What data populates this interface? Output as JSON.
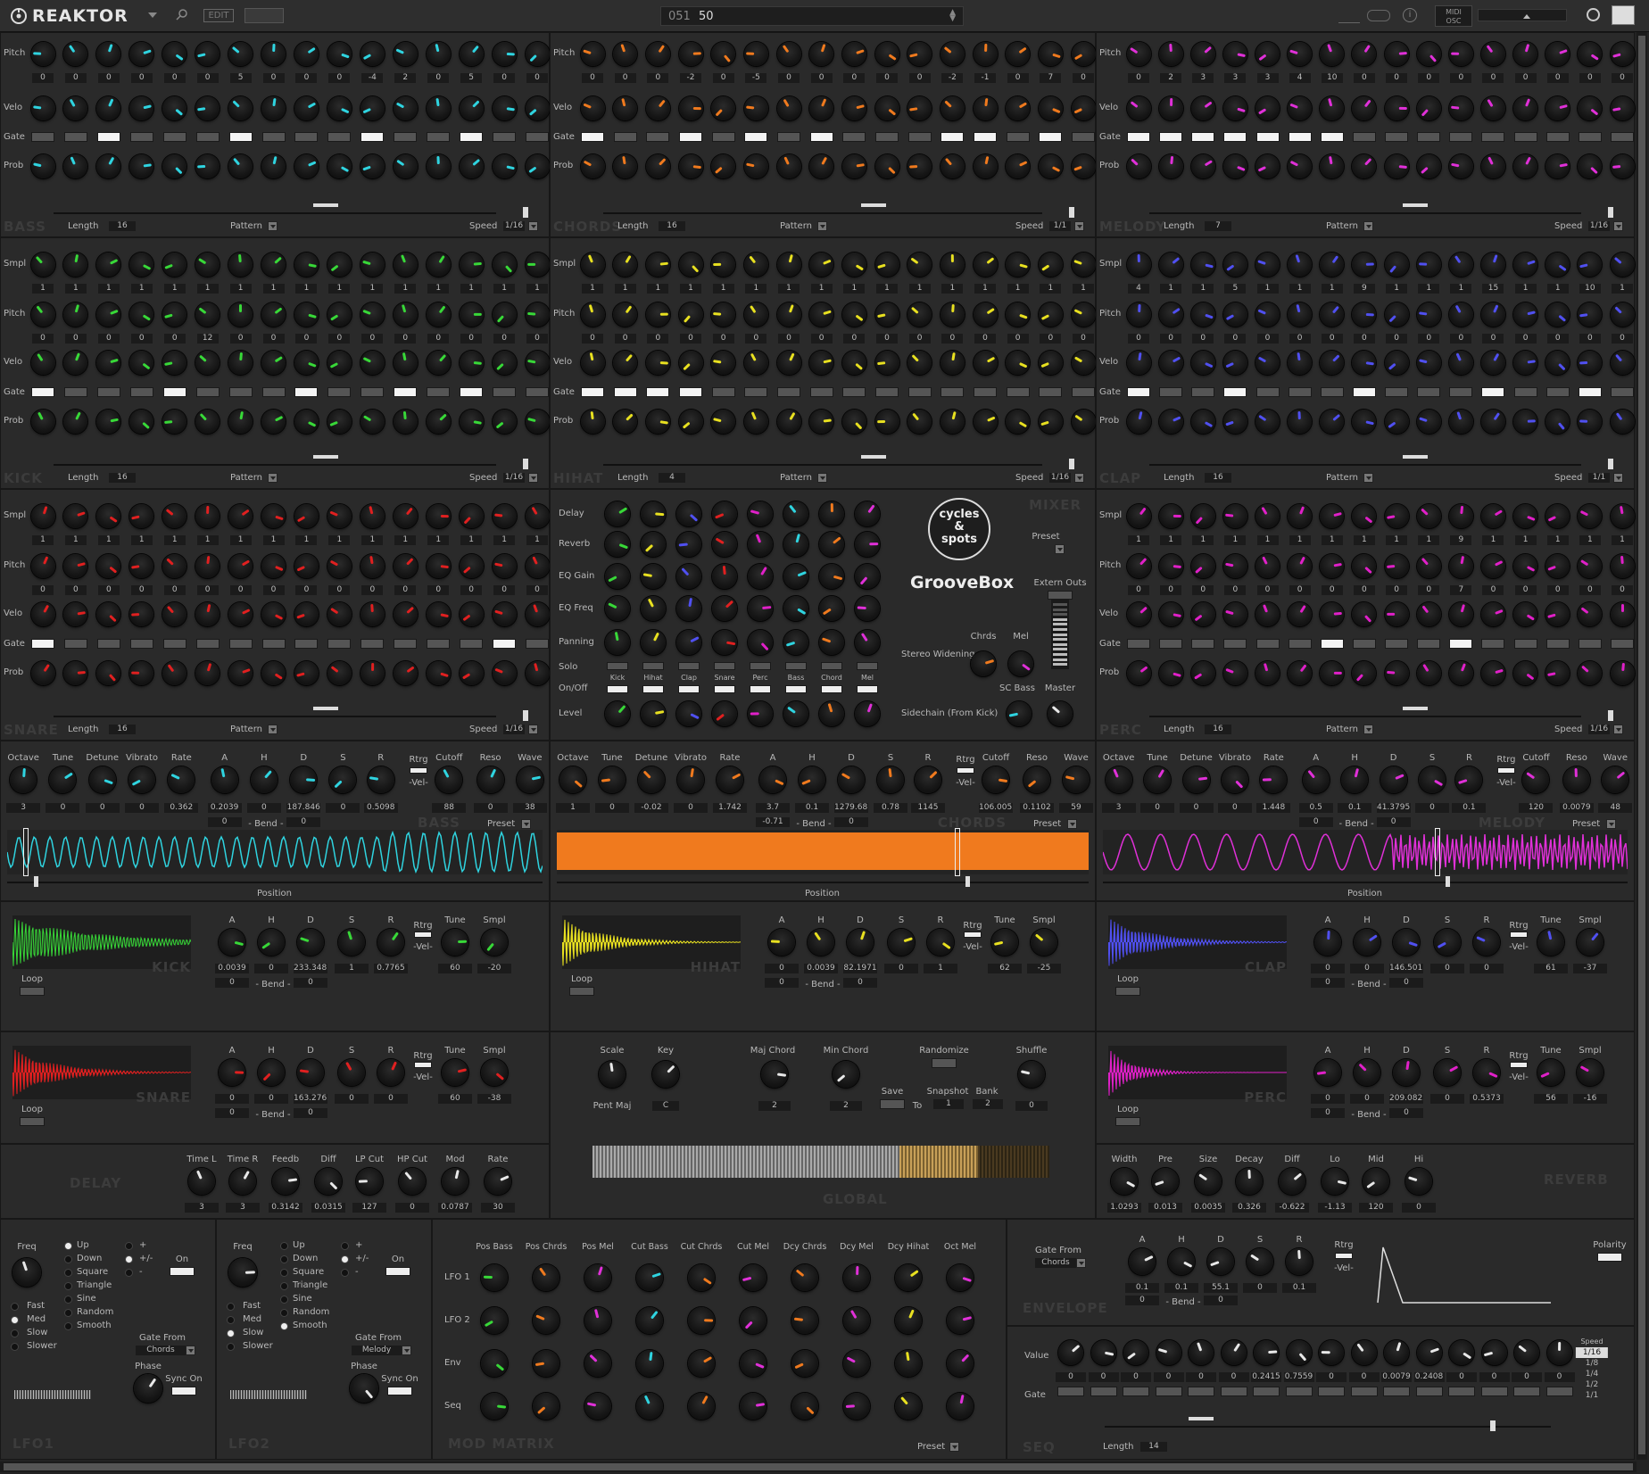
{
  "app": {
    "title": "REAKTOR",
    "edit": "EDIT",
    "snapshot_num": "051",
    "snapshot_name": "50",
    "midi": "MIDI",
    "osc": "OSC"
  },
  "colors": {
    "bass": "#2fd4e0",
    "chords": "#f07a1e",
    "melody": "#e030d8",
    "kick": "#38d838",
    "hihat": "#e8e020",
    "clap": "#5050f0",
    "snare": "#e02020",
    "perc": "#e020c8",
    "white": "#e8e8e8"
  },
  "labels": {
    "pitch": "Pitch",
    "velo": "Velo",
    "gate": "Gate",
    "prob": "Prob",
    "smpl": "Smpl",
    "length": "Length",
    "pattern": "Pattern",
    "speed": "Speed",
    "position": "Position",
    "preset": "Preset",
    "loop": "Loop",
    "rtrg": "Rtrg",
    "vel": "-Vel-",
    "bend": "- Bend -",
    "a": "A",
    "h": "H",
    "d": "D",
    "s": "S",
    "r": "R",
    "tune": "Tune",
    "octave": "Octave",
    "detune": "Detune",
    "vibrato": "Vibrato",
    "rate": "Rate",
    "cutoff": "Cutoff",
    "reso": "Reso",
    "wave": "Wave"
  },
  "seq_bass": {
    "name": "BASS",
    "pitch_vals": [
      "0",
      "0",
      "0",
      "0",
      "0",
      "0",
      "5",
      "0",
      "0",
      "0",
      "-4",
      "2",
      "0",
      "5",
      "0",
      "0"
    ],
    "length": "16",
    "speed": "1/16",
    "gates": [
      0,
      0,
      1,
      0,
      0,
      0,
      1,
      0,
      0,
      0,
      1,
      0,
      0,
      1,
      0,
      0
    ]
  },
  "seq_chords": {
    "name": "CHORDS",
    "pitch_vals": [
      "0",
      "0",
      "0",
      "-2",
      "0",
      "-5",
      "0",
      "0",
      "0",
      "0",
      "0",
      "-2",
      "-1",
      "0",
      "7",
      "0"
    ],
    "length": "16",
    "speed": "1/1",
    "gates": [
      1,
      0,
      0,
      1,
      0,
      1,
      0,
      1,
      0,
      0,
      0,
      1,
      1,
      0,
      1,
      0
    ]
  },
  "seq_melody": {
    "name": "MELODY",
    "pitch_vals": [
      "0",
      "2",
      "3",
      "3",
      "3",
      "4",
      "10",
      "0",
      "0",
      "0",
      "0",
      "0",
      "0",
      "0",
      "0",
      "0"
    ],
    "length": "7",
    "speed": "1/16",
    "gates": [
      1,
      1,
      1,
      1,
      1,
      1,
      1,
      0,
      0,
      0,
      0,
      0,
      0,
      0,
      0,
      0
    ]
  },
  "seq_kick": {
    "name": "KICK",
    "smpl_vals": [
      "1",
      "1",
      "1",
      "1",
      "1",
      "1",
      "1",
      "1",
      "1",
      "1",
      "1",
      "1",
      "1",
      "1",
      "1",
      "1"
    ],
    "pitch_vals": [
      "0",
      "0",
      "0",
      "0",
      "0",
      "12",
      "0",
      "0",
      "0",
      "0",
      "0",
      "0",
      "0",
      "0",
      "0",
      "0"
    ],
    "length": "16",
    "speed": "1/16",
    "gates": [
      1,
      0,
      0,
      0,
      1,
      0,
      0,
      0,
      1,
      0,
      0,
      1,
      0,
      1,
      0,
      0
    ]
  },
  "seq_hihat": {
    "name": "HIHAT",
    "smpl_vals": [
      "1",
      "1",
      "1",
      "1",
      "1",
      "1",
      "1",
      "1",
      "1",
      "1",
      "1",
      "1",
      "1",
      "1",
      "1",
      "1"
    ],
    "pitch_vals": [
      "0",
      "0",
      "0",
      "0",
      "0",
      "0",
      "0",
      "0",
      "0",
      "0",
      "0",
      "0",
      "0",
      "0",
      "0",
      "0"
    ],
    "length": "4",
    "speed": "1/16",
    "gates": [
      1,
      1,
      1,
      1,
      0,
      0,
      0,
      0,
      0,
      0,
      0,
      0,
      0,
      0,
      0,
      0
    ]
  },
  "seq_clap": {
    "name": "CLAP",
    "smpl_vals": [
      "4",
      "1",
      "1",
      "5",
      "1",
      "1",
      "1",
      "9",
      "1",
      "1",
      "1",
      "15",
      "1",
      "1",
      "10",
      "1"
    ],
    "pitch_vals": [
      "0",
      "0",
      "0",
      "0",
      "0",
      "0",
      "0",
      "0",
      "0",
      "0",
      "0",
      "0",
      "0",
      "0",
      "0",
      "0"
    ],
    "length": "16",
    "speed": "1/1",
    "gates": [
      1,
      0,
      0,
      1,
      0,
      0,
      0,
      1,
      0,
      0,
      0,
      1,
      0,
      0,
      1,
      0
    ]
  },
  "seq_snare": {
    "name": "SNARE",
    "smpl_vals": [
      "1",
      "1",
      "1",
      "1",
      "1",
      "1",
      "1",
      "1",
      "1",
      "1",
      "1",
      "1",
      "1",
      "1",
      "1",
      "1"
    ],
    "pitch_vals": [
      "0",
      "0",
      "0",
      "0",
      "0",
      "0",
      "0",
      "0",
      "0",
      "0",
      "0",
      "0",
      "0",
      "0",
      "0",
      "0"
    ],
    "length": "16",
    "speed": "1/16",
    "gates": [
      1,
      0,
      0,
      0,
      0,
      0,
      0,
      0,
      0,
      0,
      0,
      0,
      0,
      0,
      1,
      0
    ]
  },
  "seq_perc": {
    "name": "PERC",
    "smpl_vals": [
      "1",
      "1",
      "1",
      "1",
      "1",
      "1",
      "1",
      "1",
      "1",
      "1",
      "9",
      "1",
      "1",
      "1",
      "1",
      "1"
    ],
    "pitch_vals": [
      "0",
      "0",
      "0",
      "0",
      "0",
      "0",
      "0",
      "0",
      "0",
      "0",
      "7",
      "0",
      "0",
      "0",
      "0",
      "0"
    ],
    "length": "16",
    "speed": "1/16",
    "gates": [
      0,
      0,
      0,
      0,
      0,
      0,
      1,
      0,
      0,
      0,
      1,
      0,
      0,
      0,
      0,
      0
    ]
  },
  "mixer": {
    "title": "MIXER",
    "rows": [
      "Delay",
      "Reverb",
      "EQ Gain",
      "EQ Freq",
      "Panning",
      "Solo",
      "On/Off",
      "Level"
    ],
    "channels": [
      "Kick",
      "Hihat",
      "Clap",
      "Snare",
      "Perc",
      "Bass",
      "Chord",
      "Mel"
    ],
    "preset": "Preset",
    "extern_outs": "Extern Outs",
    "stereo_widening": "Stereo Widening",
    "chrds": "Chrds",
    "mel": "Mel",
    "sidechain": "Sidechain (From Kick)",
    "sc_bass": "SC Bass",
    "master": "Master",
    "logo_top": "cycles",
    "logo_mid": "&",
    "logo_bot": "spots",
    "logo_name": "GrooveBox"
  },
  "synth_bass": {
    "name": "BASS",
    "vals": [
      "3",
      "0",
      "0",
      "0",
      "0.362",
      "0.2039",
      "0",
      "187.846",
      "0",
      "0.5098",
      "88",
      "0",
      "38"
    ],
    "bend": [
      "0",
      "0"
    ]
  },
  "synth_chords": {
    "name": "CHORDS",
    "vals": [
      "1",
      "0",
      "-0.02",
      "0",
      "1.742",
      "3.7",
      "0.1",
      "1279.6811",
      "0.78",
      "1145",
      "106.0055",
      "0.1102",
      "59"
    ],
    "bend": [
      "-0.71",
      "0"
    ]
  },
  "synth_melody": {
    "name": "MELODY",
    "vals": [
      "3",
      "0",
      "0",
      "0",
      "1.448",
      "0.5",
      "0.1",
      "41.3795",
      "0",
      "0.1",
      "120",
      "0.0079",
      "48"
    ],
    "bend": [
      "0",
      "0"
    ]
  },
  "drum_kick": {
    "name": "KICK",
    "vals": [
      "0.0039",
      "0",
      "233.3487",
      "1",
      "0.7765",
      "60",
      "-20"
    ],
    "bend": [
      "0",
      "0"
    ]
  },
  "drum_hihat": {
    "name": "HIHAT",
    "vals": [
      "0",
      "0.0039",
      "82.1971",
      "0",
      "1",
      "62",
      "-25"
    ],
    "bend": [
      "0",
      "0"
    ]
  },
  "drum_clap": {
    "name": "CLAP",
    "vals": [
      "0",
      "0",
      "146.5015",
      "0",
      "0",
      "61",
      "-37"
    ],
    "bend": [
      "0",
      "0"
    ]
  },
  "drum_snare": {
    "name": "SNARE",
    "vals": [
      "0",
      "0",
      "163.2765",
      "0",
      "0",
      "60",
      "-38"
    ],
    "bend": [
      "0",
      "0"
    ]
  },
  "drum_perc": {
    "name": "PERC",
    "vals": [
      "0",
      "0",
      "209.0822",
      "0",
      "0.5373",
      "56",
      "-16"
    ],
    "bend": [
      "0",
      "0"
    ]
  },
  "global": {
    "title": "GLOBAL",
    "scale": "Scale",
    "scale_val": "Pent Maj",
    "key": "Key",
    "key_val": "C",
    "maj_chord": "Maj Chord",
    "maj_val": "2",
    "min_chord": "Min Chord",
    "min_val": "2",
    "randomize": "Randomize",
    "shuffle": "Shuffle",
    "shuffle_val": "0",
    "save": "Save",
    "to": "To",
    "snapshot": "Snapshot",
    "snapshot_val": "1",
    "bank": "Bank",
    "bank_val": "2"
  },
  "delay": {
    "title": "DELAY",
    "labels": [
      "Time L",
      "Time R",
      "Feedb",
      "Diff",
      "LP Cut",
      "HP Cut",
      "Mod",
      "Rate"
    ],
    "vals": [
      "3",
      "3",
      "0.3142",
      "0.0315",
      "127",
      "0",
      "0.0787",
      "30"
    ]
  },
  "reverb": {
    "title": "REVERB",
    "labels": [
      "Width",
      "Pre",
      "Size",
      "Decay",
      "Diff",
      "Lo",
      "Mid",
      "Hi"
    ],
    "vals": [
      "1.0293",
      "0.013",
      "0.0035",
      "0.326",
      "-0.622",
      "-1.13",
      "120",
      "0"
    ]
  },
  "lfo1": {
    "title": "LFO1",
    "freq": "Freq",
    "shapes": [
      "Up",
      "Down",
      "Square",
      "Triangle",
      "Sine",
      "Random",
      "Smooth"
    ],
    "speeds": [
      "Fast",
      "Med",
      "Slow",
      "Slower"
    ],
    "pol": [
      "+",
      "+/-",
      "-"
    ],
    "on": "On",
    "gate_from": "Gate From",
    "gate_val": "Chords",
    "phase": "Phase",
    "sync_on": "Sync On"
  },
  "lfo2": {
    "title": "LFO2",
    "freq": "Freq",
    "shapes": [
      "Up",
      "Down",
      "Square",
      "Triangle",
      "Sine",
      "Random",
      "Smooth"
    ],
    "speeds": [
      "Fast",
      "Med",
      "Slow",
      "Slower"
    ],
    "pol": [
      "+",
      "+/-",
      "-"
    ],
    "on": "On",
    "gate_from": "Gate From",
    "gate_val": "Melody",
    "phase": "Phase",
    "sync_on": "Sync On"
  },
  "modmatrix": {
    "title": "MOD MATRIX",
    "cols": [
      "Pos Bass",
      "Pos Chrds",
      "Pos Mel",
      "Cut Bass",
      "Cut Chrds",
      "Cut Mel",
      "Dcy Chrds",
      "Dcy Mel",
      "Dcy Hihat",
      "Oct Mel"
    ],
    "rows": [
      "LFO 1",
      "LFO 2",
      "Env",
      "Seq"
    ],
    "preset": "Preset"
  },
  "envelope": {
    "title": "ENVELOPE",
    "gate_from": "Gate From",
    "gate_val": "Chords",
    "vals": [
      "0.1",
      "0.1",
      "55.1",
      "0",
      "0.1"
    ],
    "bend": [
      "0",
      "0"
    ],
    "polarity": "Polarity"
  },
  "seq": {
    "title": "SEQ",
    "value": "Value",
    "gate": "Gate",
    "vals": [
      "0",
      "0",
      "0",
      "0",
      "0",
      "0",
      "0.2415",
      "0.7559",
      "0",
      "0",
      "0.0079",
      "0.2408",
      "0",
      "0",
      "0",
      "0"
    ],
    "length": "Length",
    "length_val": "14",
    "speed": "Speed",
    "speeds": [
      "1/16",
      "1/8",
      "1/4",
      "1/2",
      "1/1"
    ]
  }
}
